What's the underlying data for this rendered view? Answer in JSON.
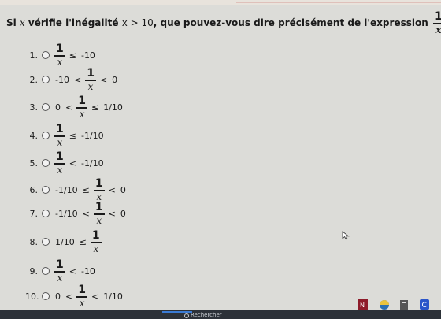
{
  "question": {
    "prefix": "Si",
    "var": "x",
    "middle_a": "vérifie l'inégalité",
    "ineq": "x > 10",
    "middle_b": ", que pouvez-vous dire précisément de l'expression",
    "frac_num": "1",
    "frac_den": "x",
    "suffix": "?"
  },
  "options": [
    {
      "n": "1.",
      "left": "",
      "lop": "",
      "right_op": "≤",
      "right": "-10"
    },
    {
      "n": "2.",
      "left": "-10",
      "lop": "<",
      "right_op": "<",
      "right": "0"
    },
    {
      "n": "3.",
      "left": "0",
      "lop": "<",
      "right_op": "≤",
      "right": "1/10"
    },
    {
      "n": "4.",
      "left": "",
      "lop": "",
      "right_op": "≤",
      "right": "-1/10"
    },
    {
      "n": "5.",
      "left": "",
      "lop": "",
      "right_op": "<",
      "right": "-1/10"
    },
    {
      "n": "6.",
      "left": "-1/10",
      "lop": "≤",
      "right_op": "<",
      "right": "0"
    },
    {
      "n": "7.",
      "left": "-1/10",
      "lop": "<",
      "right_op": "<",
      "right": "0"
    },
    {
      "n": "8.",
      "left": "1/10",
      "lop": "≤",
      "right_op": "",
      "right": ""
    },
    {
      "n": "9.",
      "left": "",
      "lop": "",
      "right_op": "<",
      "right": "-10"
    },
    {
      "n": "10.",
      "left": "0",
      "lop": "<",
      "right_op": "<",
      "right": "1/10"
    }
  ],
  "fraction": {
    "num": "1",
    "den": "x"
  },
  "taskbar": {
    "search_placeholder": "Rechercher"
  },
  "colors": {
    "taskbar": "#2c3138",
    "accent": "#3a7bd5"
  }
}
